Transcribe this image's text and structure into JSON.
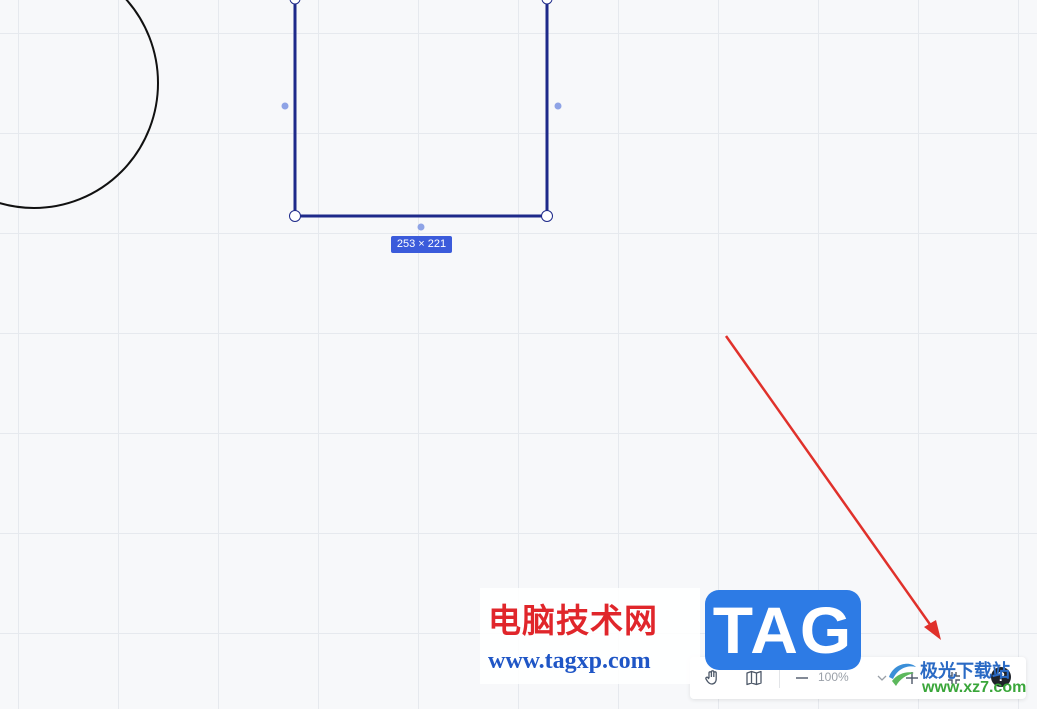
{
  "canvas": {
    "background": "#f7f8fa",
    "grid_color": "#e6e9ee"
  },
  "selection": {
    "size_label": "253 × 221",
    "stroke_color": "#1e2a8a",
    "handle_color": "#8ea3e6"
  },
  "toolbar": {
    "hand_tool_icon": "hand-icon",
    "map_icon": "map-icon",
    "zoom_out_icon": "minus-icon",
    "zoom_value": "100%",
    "zoom_dropdown_icon": "chevron-down-icon",
    "zoom_in_icon": "plus-icon",
    "fit_icon": "fit-screen-icon",
    "help_label": "?"
  },
  "annotation": {
    "arrow_color": "#e0312b"
  },
  "watermark": {
    "site_name": "电脑技术网",
    "site_url": "www.tagxp.com",
    "tag_text": "TAG",
    "brand_name": "极光下载站",
    "brand_url": "www.xz7.com"
  }
}
